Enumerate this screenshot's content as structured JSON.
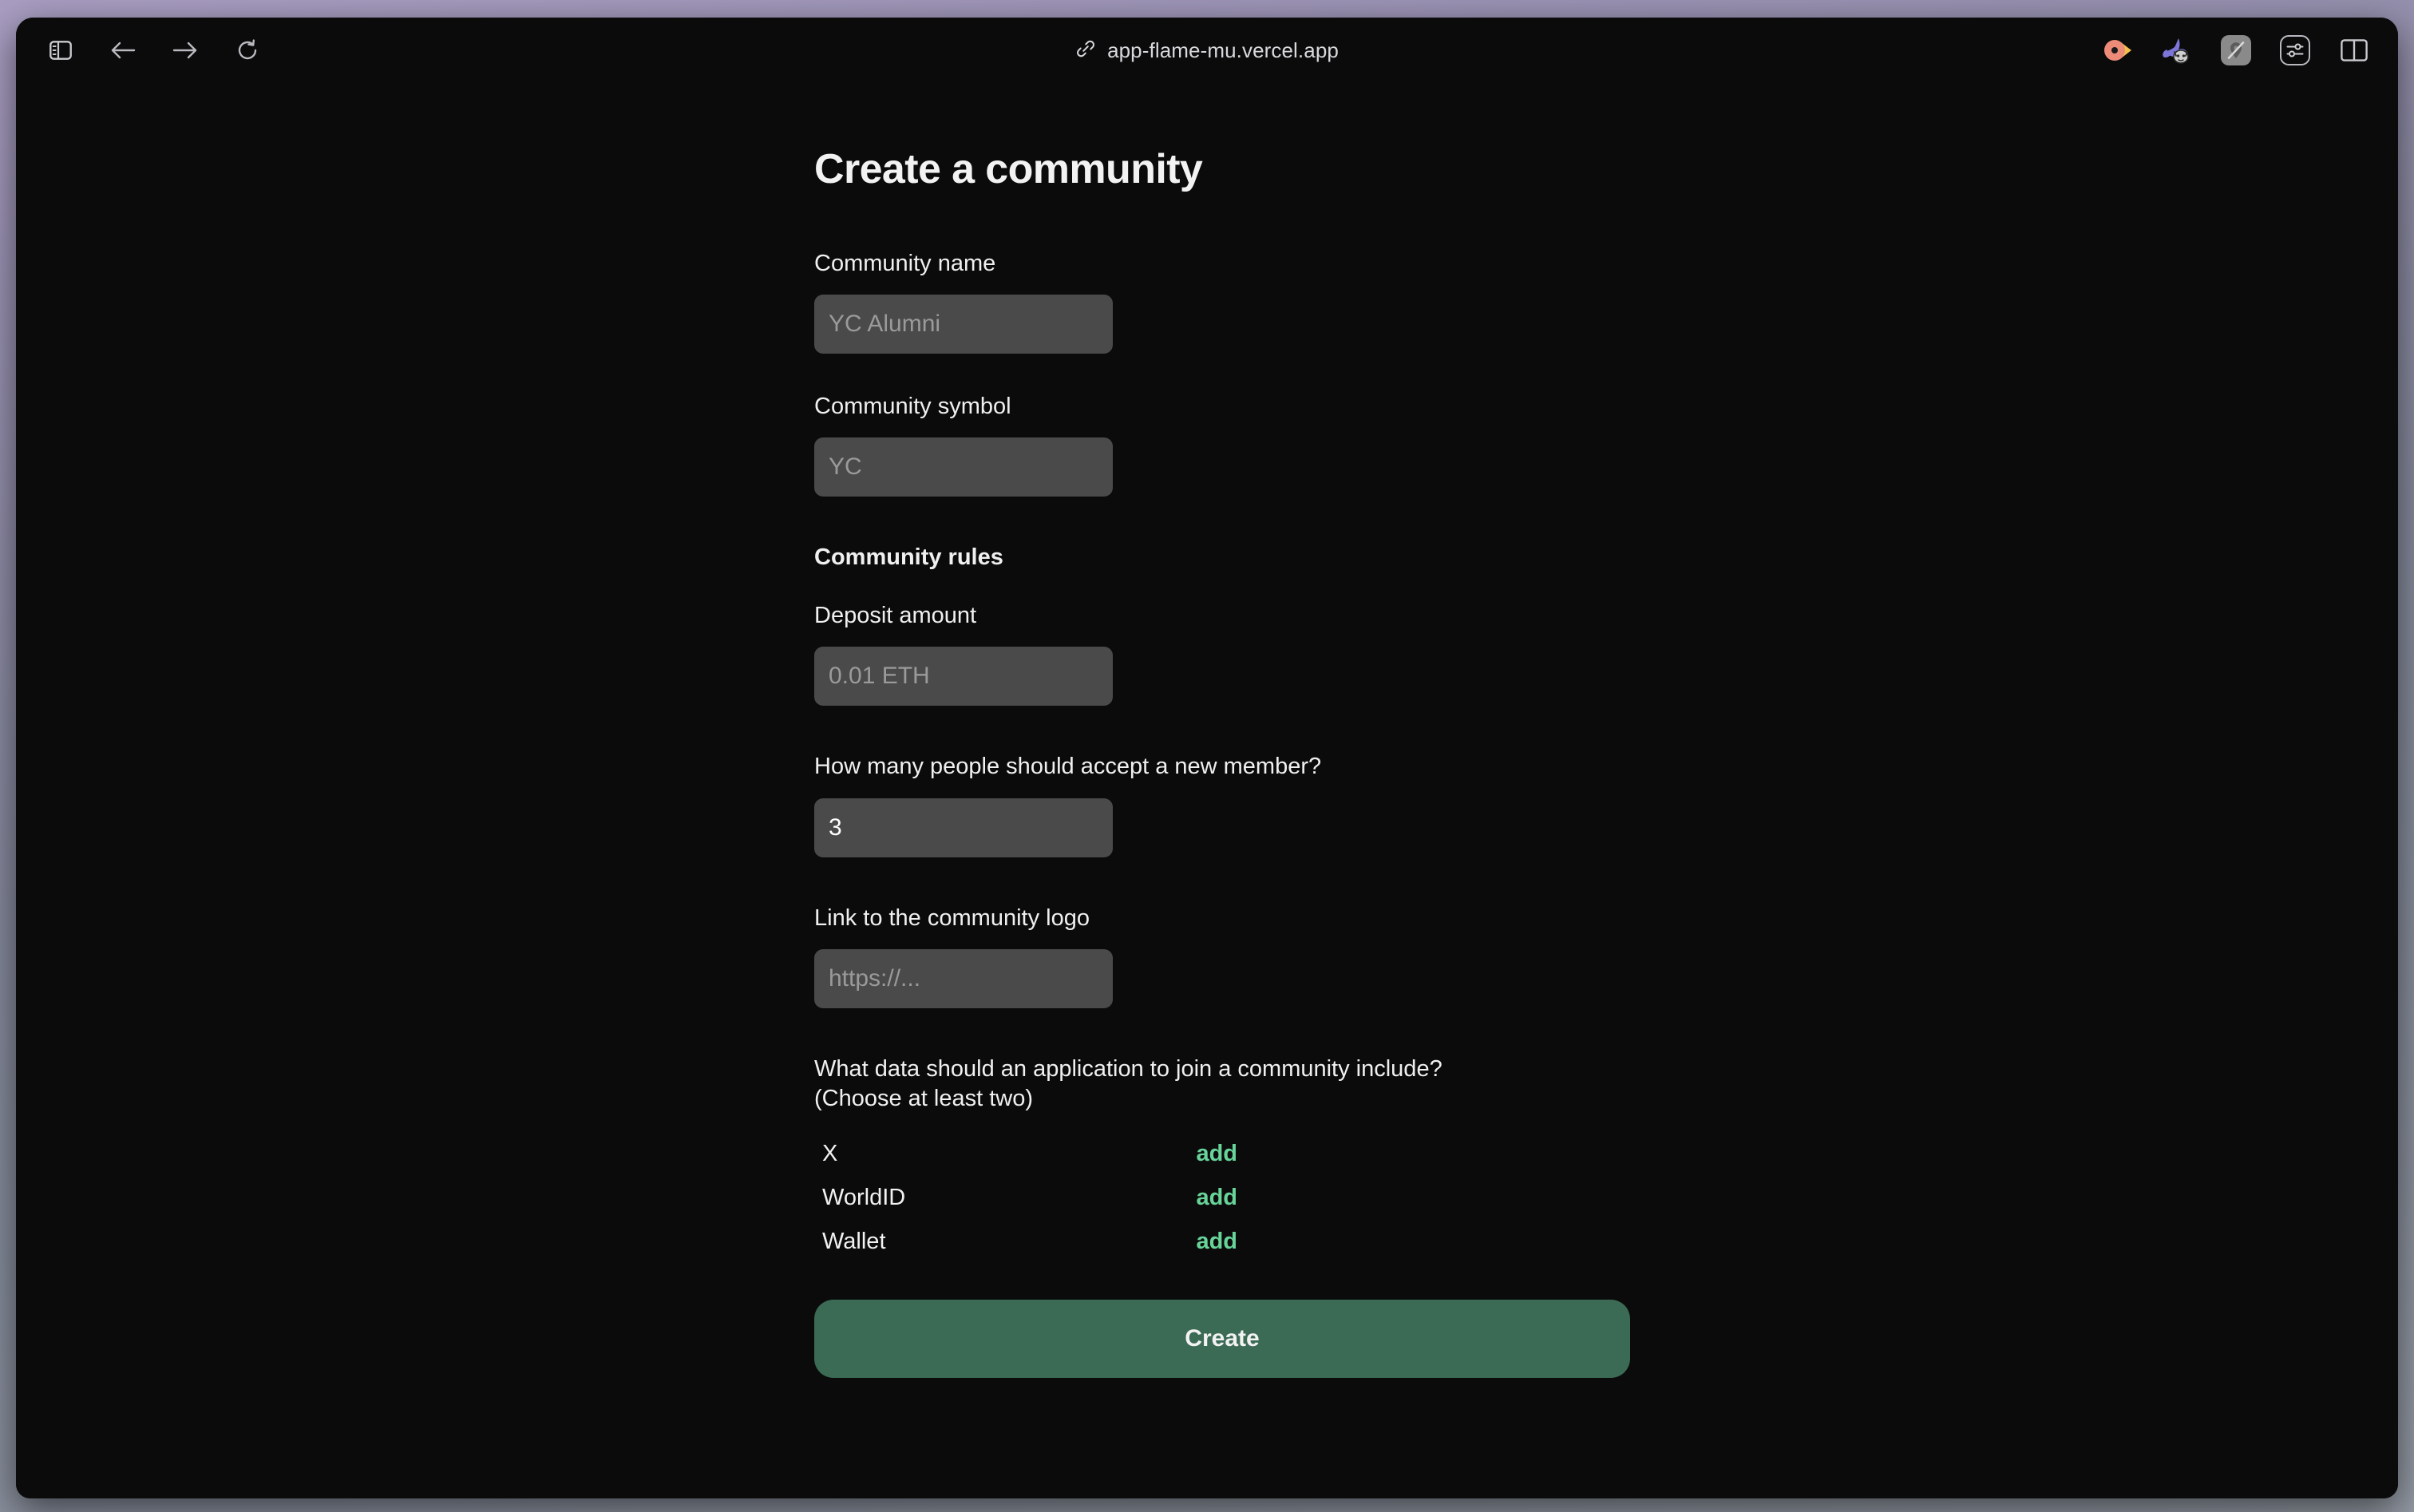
{
  "browser": {
    "address": "app-flame-mu.vercel.app",
    "link_icon": "link-icon",
    "sidebar_toggle": "sidebar-toggle-icon",
    "back": "back-arrow-icon",
    "forward": "forward-arrow-icon",
    "reload": "reload-icon",
    "extensions": [
      {
        "name": "raycast-extension-icon"
      },
      {
        "name": "rabbit-cat-extension-icon"
      },
      {
        "name": "location-off-extension-icon"
      },
      {
        "name": "sliders-extension-icon"
      },
      {
        "name": "tab-split-view-icon"
      }
    ]
  },
  "page": {
    "title": "Create a community",
    "fields": {
      "community_name": {
        "label": "Community name",
        "placeholder": "YC Alumni",
        "value": ""
      },
      "community_symbol": {
        "label": "Community symbol",
        "placeholder": "YC",
        "value": ""
      },
      "rules_heading": "Community rules",
      "deposit_amount": {
        "label": "Deposit amount",
        "placeholder": "0.01 ETH",
        "value": ""
      },
      "acceptors": {
        "label": "How many people should accept a new member?",
        "placeholder": "",
        "value": "3"
      },
      "logo_link": {
        "label": "Link to the community logo",
        "placeholder": "https://...",
        "value": ""
      },
      "application_data": {
        "label_line1": "What data should an application to join a community include?",
        "label_line2": "(Choose at least two)",
        "options": [
          {
            "name": "X",
            "action": "add"
          },
          {
            "name": "WorldID",
            "action": "add"
          },
          {
            "name": "Wallet",
            "action": "add"
          }
        ]
      }
    },
    "submit_label": "Create"
  },
  "colors": {
    "page_bg": "#0b0b0b",
    "input_bg": "#4a4a4a",
    "accent_green": "#68d49a",
    "button_green": "#3b6b54",
    "text": "#f2f2f3",
    "placeholder": "#9a9a9a"
  }
}
